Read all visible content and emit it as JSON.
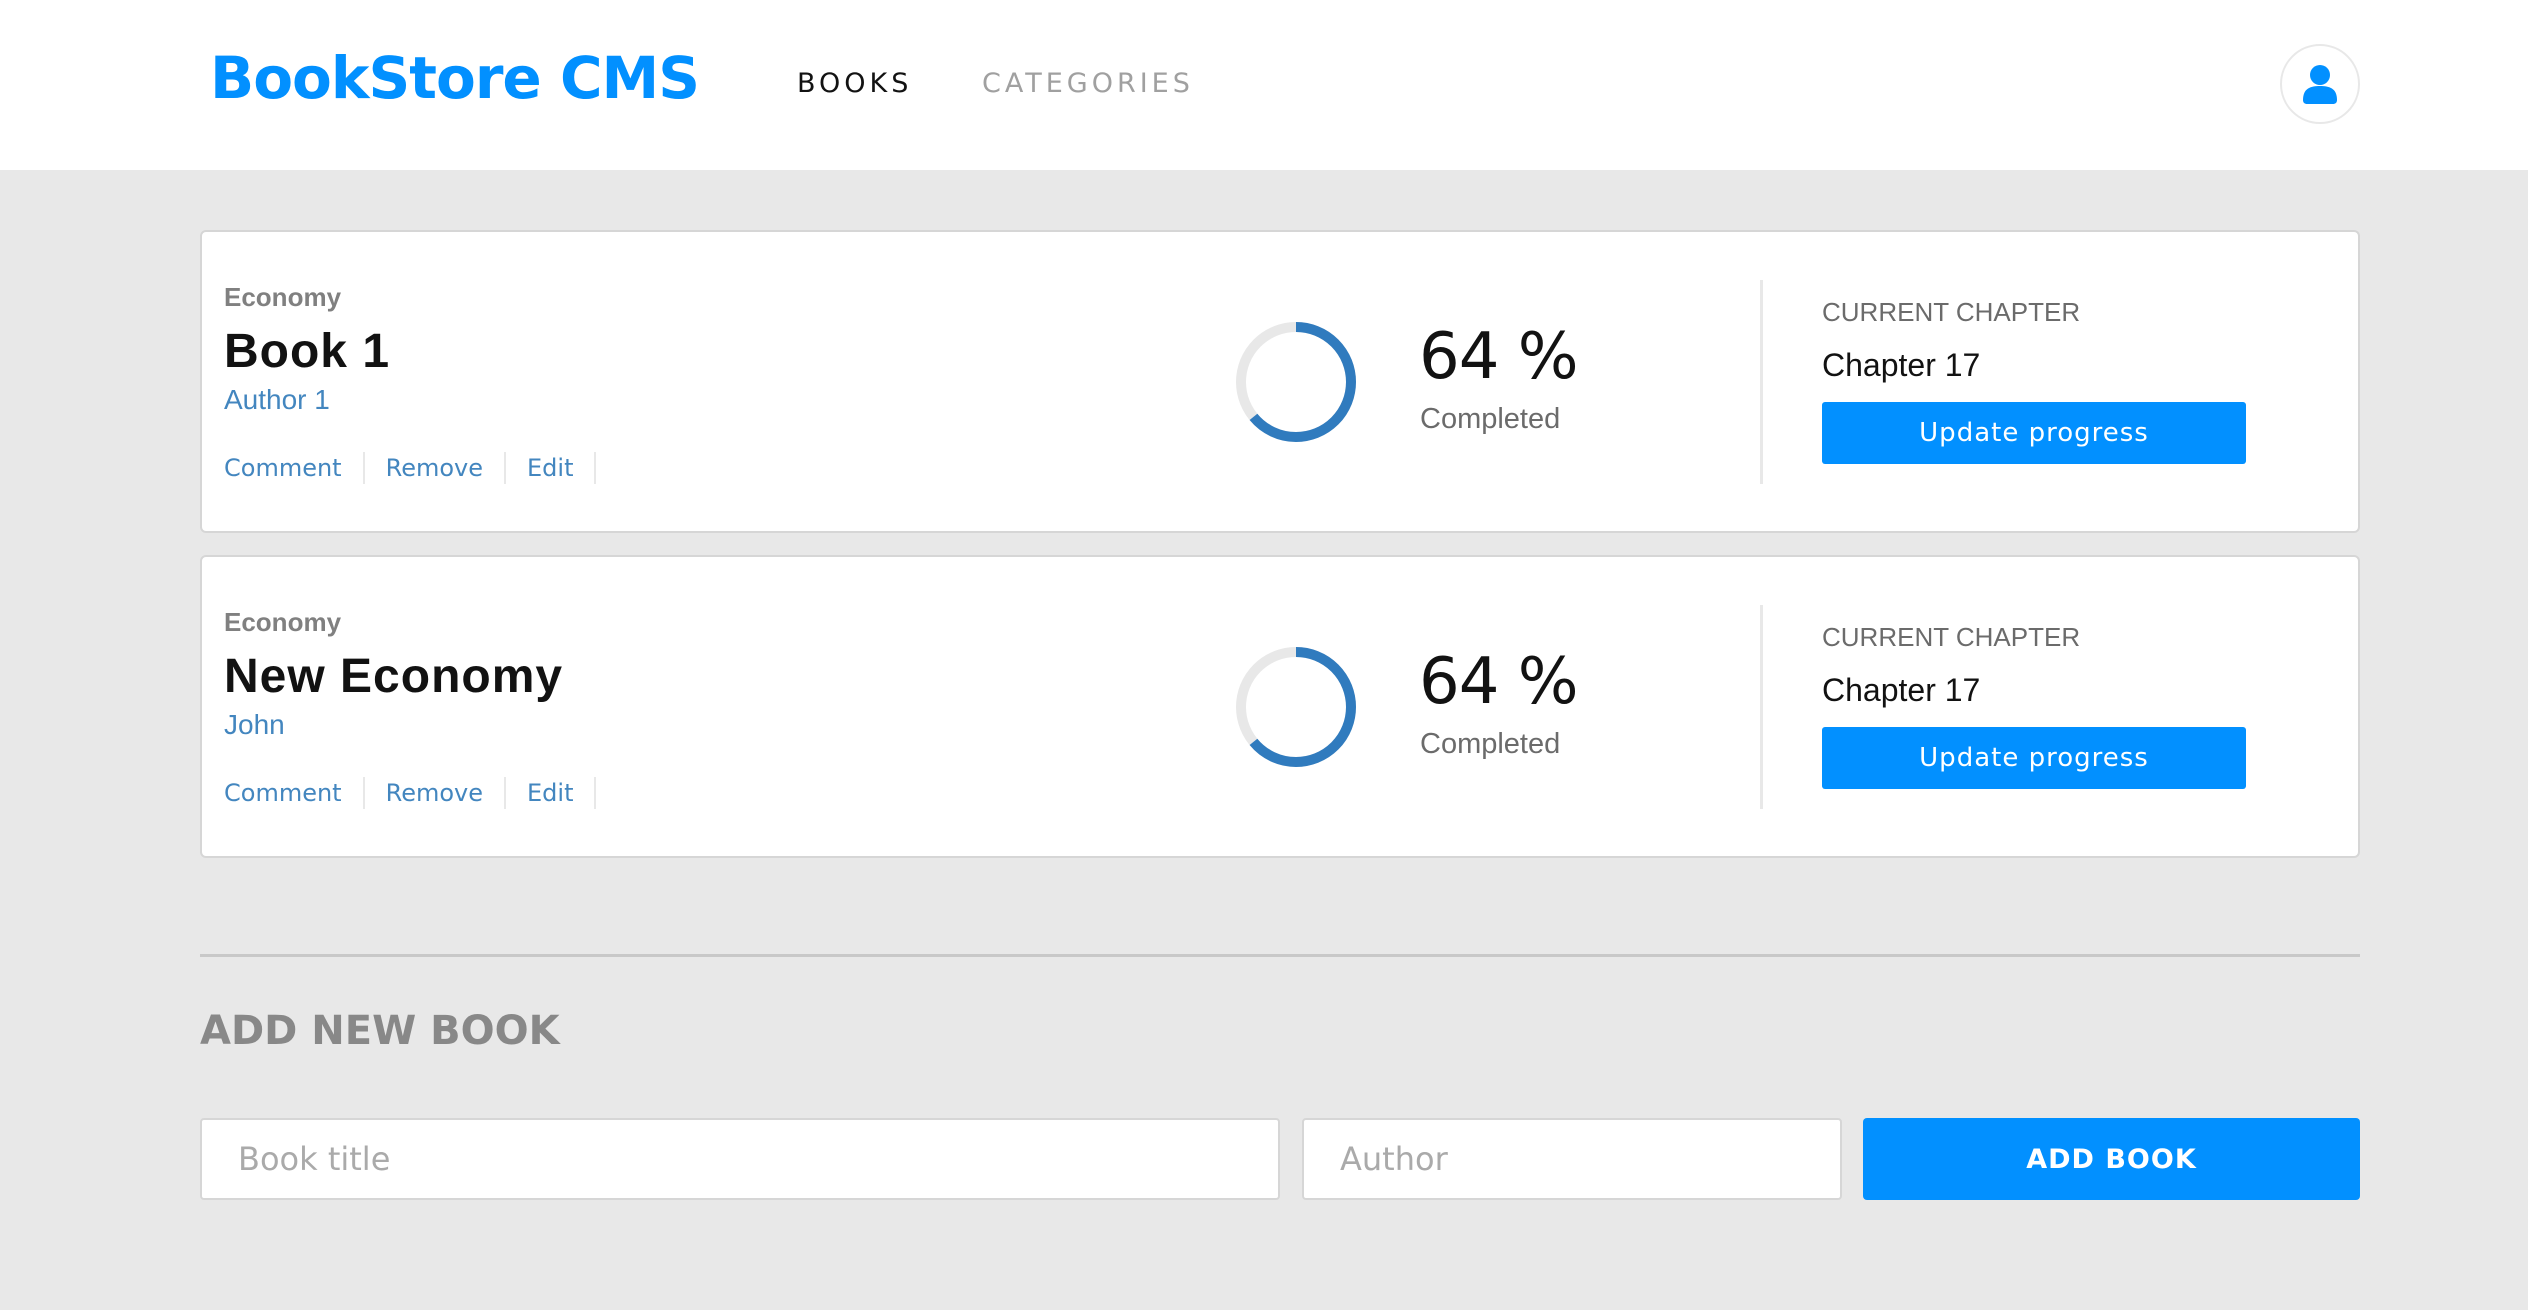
{
  "header": {
    "logo": "BookStore CMS",
    "nav": [
      {
        "label": "BOOKS",
        "active": true
      },
      {
        "label": "CATEGORIES",
        "active": false
      }
    ],
    "user_icon": "user-icon"
  },
  "books": [
    {
      "genre": "Economy",
      "title": "Book 1",
      "author": "Author 1",
      "actions": [
        "Comment",
        "Remove",
        "Edit"
      ],
      "progress_percent": 64,
      "percent_text": "64 %",
      "completed_label": "Completed",
      "chapter_label": "CURRENT CHAPTER",
      "chapter": "Chapter 17",
      "update_label": "Update progress"
    },
    {
      "genre": "Economy",
      "title": "New Economy",
      "author": "John",
      "actions": [
        "Comment",
        "Remove",
        "Edit"
      ],
      "progress_percent": 64,
      "percent_text": "64 %",
      "completed_label": "Completed",
      "chapter_label": "CURRENT CHAPTER",
      "chapter": "Chapter 17",
      "update_label": "Update progress"
    }
  ],
  "form": {
    "title": "ADD NEW BOOK",
    "title_placeholder": "Book title",
    "author_placeholder": "Author",
    "submit_label": "ADD BOOK"
  },
  "colors": {
    "accent": "#0290ff",
    "progress": "#307bbe",
    "track": "#e8e8e8",
    "background": "#e8e8e8"
  }
}
